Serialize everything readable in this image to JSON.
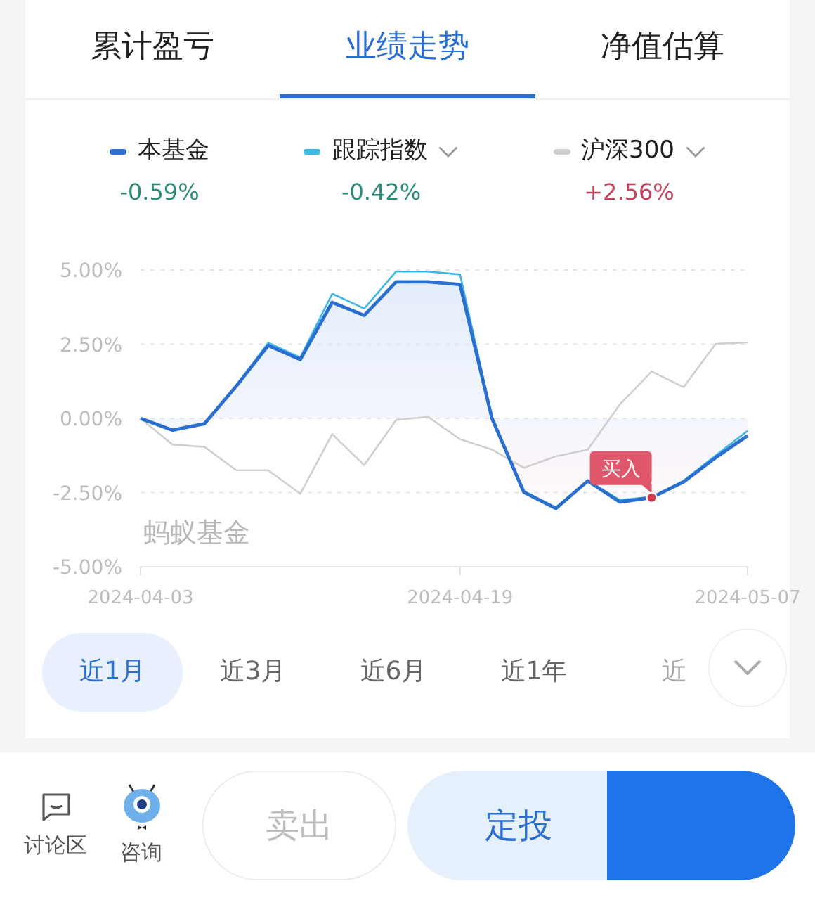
{
  "tabs": [
    {
      "label": "累计盈亏",
      "selected": false
    },
    {
      "label": "业绩走势",
      "selected": true
    },
    {
      "label": "净值估算",
      "selected": false
    }
  ],
  "legend": [
    {
      "change": "-0.59%",
      "color": "#2d8a78",
      "dropdown": false
    },
    {
      "change": "-0.42%",
      "color": "#2d8a78",
      "dropdown": true
    },
    {
      "change": "+2.56%",
      "color": "#c4425d",
      "dropdown": true
    }
  ],
  "chart_data": {
    "type": "line",
    "categories": [
      "2024-04-03",
      null,
      null,
      null,
      null,
      null,
      null,
      null,
      null,
      null,
      "2024-04-19",
      null,
      null,
      null,
      null,
      null,
      null,
      null,
      null,
      "2024-05-07"
    ],
    "series": [
      {
        "name": "本基金",
        "type": "area",
        "color": "#2a6fd0",
        "values": [
          0,
          -0.4,
          -0.18,
          1.09,
          2.46,
          1.98,
          3.91,
          3.47,
          4.6,
          4.6,
          4.51,
          0,
          -2.49,
          -3.04,
          -2.11,
          -2.82,
          -2.67,
          -2.14,
          -1.32,
          -0.59
        ]
      },
      {
        "name": "跟踪指数",
        "type": "line",
        "color": "#3db8e6",
        "values": [
          0,
          -0.4,
          -0.18,
          1.1,
          2.55,
          2.05,
          4.2,
          3.7,
          4.95,
          4.95,
          4.85,
          0.05,
          -2.45,
          -3.0,
          -2.1,
          -2.75,
          -2.65,
          -2.1,
          -1.25,
          -0.42
        ]
      },
      {
        "name": "沪深300",
        "type": "line",
        "color": "#cfcfcf",
        "values": [
          0,
          -0.88,
          -0.96,
          -1.75,
          -1.75,
          -2.54,
          -0.53,
          -1.58,
          -0.05,
          0.05,
          -0.7,
          -1.05,
          -1.67,
          -1.28,
          -1.05,
          0.47,
          1.58,
          1.05,
          2.51,
          2.56
        ]
      }
    ],
    "ylim": [
      -5,
      5
    ],
    "grid": true,
    "yticks": [
      {
        "value": 5,
        "label": "5.00%"
      },
      {
        "value": 2.5,
        "label": "2.50%"
      },
      {
        "value": 0,
        "label": "0.00%"
      },
      {
        "value": -2.5,
        "label": "-2.50%"
      },
      {
        "value": -5,
        "label": "-5.00%"
      }
    ],
    "annotations": [
      "买入"
    ]
  },
  "chart_watermark": "蚂蚁基金",
  "periods": [
    {
      "label": "近1月",
      "selected": true
    },
    {
      "label": "近3月",
      "selected": false
    },
    {
      "label": "近6月",
      "selected": false
    },
    {
      "label": "近1年",
      "selected": false
    },
    {
      "label": "近",
      "selected": false
    }
  ],
  "bottom_bar": {
    "links": [
      {
        "label": "讨论区",
        "kind": "comment"
      },
      {
        "label": "咨询",
        "kind": "assistant"
      }
    ],
    "buttons": [
      {
        "label": "卖出",
        "kind": "outline"
      },
      {
        "label": "定投",
        "kind": "soft"
      },
      {
        "kind": "primary"
      }
    ]
  }
}
